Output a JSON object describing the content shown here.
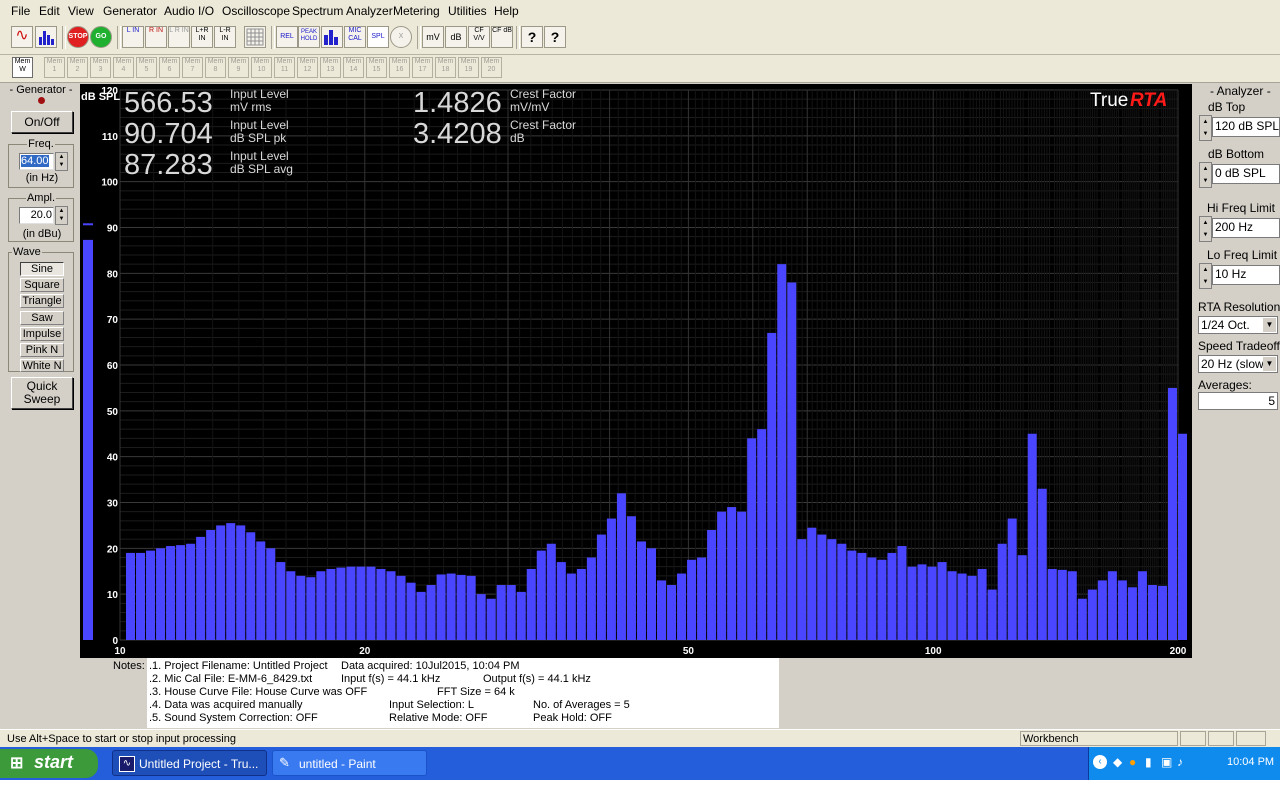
{
  "menu": [
    "File",
    "Edit",
    "View",
    "Generator",
    "Audio I/O",
    "Oscilloscope",
    "Spectrum Analyzer",
    "Metering",
    "Utilities",
    "Help"
  ],
  "toolbar": {
    "buttons": [
      {
        "name": "sine-wave-icon",
        "label": "~"
      },
      {
        "name": "spectrum-icon",
        "label": ""
      },
      {
        "name": "stop-icon",
        "label": "STOP"
      },
      {
        "name": "go-icon",
        "label": "GO"
      },
      {
        "name": "l-in-button",
        "label": "L IN"
      },
      {
        "name": "r-in-button",
        "label": "R IN"
      },
      {
        "name": "l-r-in-button",
        "label": "L R IN"
      },
      {
        "name": "l-plus-r-in-button",
        "label": "L+R IN"
      },
      {
        "name": "l-minus-r-in-button",
        "label": "L-R IN"
      },
      {
        "name": "grid-icon",
        "label": ""
      },
      {
        "name": "rel-button",
        "label": "REL"
      },
      {
        "name": "peak-hold-button",
        "label": "PEAK HOLD"
      },
      {
        "name": "bars-icon",
        "label": ""
      },
      {
        "name": "mic-cal-button",
        "label": "MIC CAL"
      },
      {
        "name": "spl-button",
        "label": "SPL"
      },
      {
        "name": "x-icon",
        "label": "X"
      },
      {
        "name": "mv-button",
        "label": "mV"
      },
      {
        "name": "db-button",
        "label": "dB"
      },
      {
        "name": "cf-v-button",
        "label": "CF V/V"
      },
      {
        "name": "cf-db-button",
        "label": "CF dB"
      },
      {
        "name": "help-icon",
        "label": "?"
      },
      {
        "name": "context-help-icon",
        "label": "?"
      }
    ]
  },
  "memory": {
    "active_label": "Mem W",
    "items": [
      "1",
      "2",
      "3",
      "4",
      "5",
      "6",
      "7",
      "8",
      "9",
      "10",
      "11",
      "12",
      "13",
      "14",
      "15",
      "16",
      "17",
      "18",
      "19",
      "20"
    ],
    "prefix": "Mem"
  },
  "generator": {
    "title": "- Generator -",
    "on_off": "On/Off",
    "freq_title": "Freq.",
    "freq_value": "64.00",
    "freq_unit": "(in Hz)",
    "ampl_title": "Ampl.",
    "ampl_value": "20.0",
    "ampl_unit": "(in dBu)",
    "wave_title": "Wave",
    "waves": [
      "Sine",
      "Square",
      "Triangle",
      "Saw",
      "Impulse",
      "Pink N",
      "White N"
    ],
    "selected_wave": "Sine",
    "quick_sweep": "Quick Sweep"
  },
  "analyzer": {
    "title": "- Analyzer -",
    "db_top_label": "dB Top",
    "db_top": "120 dB SPL",
    "db_bottom_label": "dB Bottom",
    "db_bottom": "0 dB SPL",
    "hi_freq_label": "Hi Freq Limit",
    "hi_freq": "200 Hz",
    "lo_freq_label": "Lo Freq Limit",
    "lo_freq": "10 Hz",
    "rta_res_label": "RTA Resolution:",
    "rta_res": "1/24 Oct.",
    "speed_label": "Speed Tradeoff:",
    "speed": "20 Hz (slow)",
    "averages_label": "Averages:",
    "averages": "5"
  },
  "readouts": {
    "level_mv": "566.53",
    "level_mv_label1": "Input Level",
    "level_mv_label2": "mV rms",
    "level_pk": "90.704",
    "level_pk_label1": "Input Level",
    "level_pk_label2": "dB SPL pk",
    "level_avg": "87.283",
    "level_avg_label1": "Input Level",
    "level_avg_label2": "dB SPL avg",
    "crest1": "1.4826",
    "crest1_label1": "Crest Factor",
    "crest1_label2": "mV/mV",
    "crest2": "3.4208",
    "crest2_label1": "Crest Factor",
    "crest2_label2": "dB",
    "logo_true": "True",
    "logo_rta": "RTA"
  },
  "chart_data": {
    "type": "bar",
    "ylabel": "dB SPL",
    "ylim": [
      0,
      120
    ],
    "yticks": [
      0,
      10,
      20,
      30,
      40,
      50,
      60,
      70,
      80,
      90,
      100,
      110,
      120
    ],
    "x_scale": "log",
    "xlim": [
      10,
      200
    ],
    "xtick_labels": [
      {
        "value": 10,
        "label": "10"
      },
      {
        "value": 20,
        "label": "20"
      },
      {
        "value": 50,
        "label": "50"
      },
      {
        "value": 100,
        "label": "100"
      },
      {
        "value": 200,
        "label": "200"
      }
    ],
    "level_meter_db": 87.3,
    "level_meter_peak_db": 90.7,
    "values": [
      19,
      19,
      19.5,
      20,
      20.5,
      20.7,
      21,
      22.5,
      24,
      25,
      25.5,
      25,
      23.5,
      21.5,
      20,
      17,
      15,
      14,
      13.7,
      15,
      15.5,
      15.8,
      16,
      16,
      16,
      15.5,
      15,
      14,
      12.5,
      10.5,
      12,
      14.3,
      14.5,
      14.2,
      14,
      10,
      9,
      12,
      12,
      10.5,
      15.5,
      19.5,
      21,
      17,
      14.5,
      15.5,
      18,
      23,
      26.5,
      32,
      27,
      21.5,
      20,
      13,
      12,
      14.5,
      17.5,
      18,
      24,
      28,
      29,
      28,
      44,
      46,
      67,
      82,
      78,
      22,
      24.5,
      23,
      22,
      21,
      19.5,
      19,
      18,
      17.5,
      19,
      20.5,
      16,
      16.5,
      16,
      17,
      15,
      14.5,
      14,
      15.5,
      11,
      21,
      26.5,
      18.5,
      45,
      33,
      15.5,
      15.3,
      15,
      9,
      11,
      13,
      15,
      13,
      11.5,
      15,
      12,
      11.8,
      55,
      45
    ]
  },
  "notes": {
    "label": "Notes:",
    "lines": [
      ".1. Project Filename: Untitled Project",
      ".2. Mic Cal File: E-MM-6_8429.txt",
      ".3. House Curve File: House Curve was OFF",
      ".4. Data was acquired manually",
      ".5. Sound System Correction: OFF"
    ],
    "acquired": "Data acquired: 10Jul2015, 10:04 PM",
    "input_fs": "Input f(s) = 44.1 kHz",
    "output_fs": "Output f(s) = 44.1 kHz",
    "fft_size": "FFT Size = 64 k",
    "input_sel": "Input Selection: L",
    "num_avg": "No. of Averages = 5",
    "rel_mode": "Relative Mode:  OFF",
    "peak_hold": "Peak Hold: OFF"
  },
  "statusbar": {
    "hint": "Use Alt+Space to start or stop input processing",
    "mode": "Workbench"
  },
  "taskbar": {
    "start": "start",
    "tasks": [
      "Untitled Project - Tru...",
      "untitled - Paint"
    ],
    "clock": "10:04 PM"
  },
  "colors": {
    "bar": "#4a46ff",
    "plot_bg": "#000000",
    "accent_red": "#ff1a1a",
    "taskbar": "#245edb"
  }
}
